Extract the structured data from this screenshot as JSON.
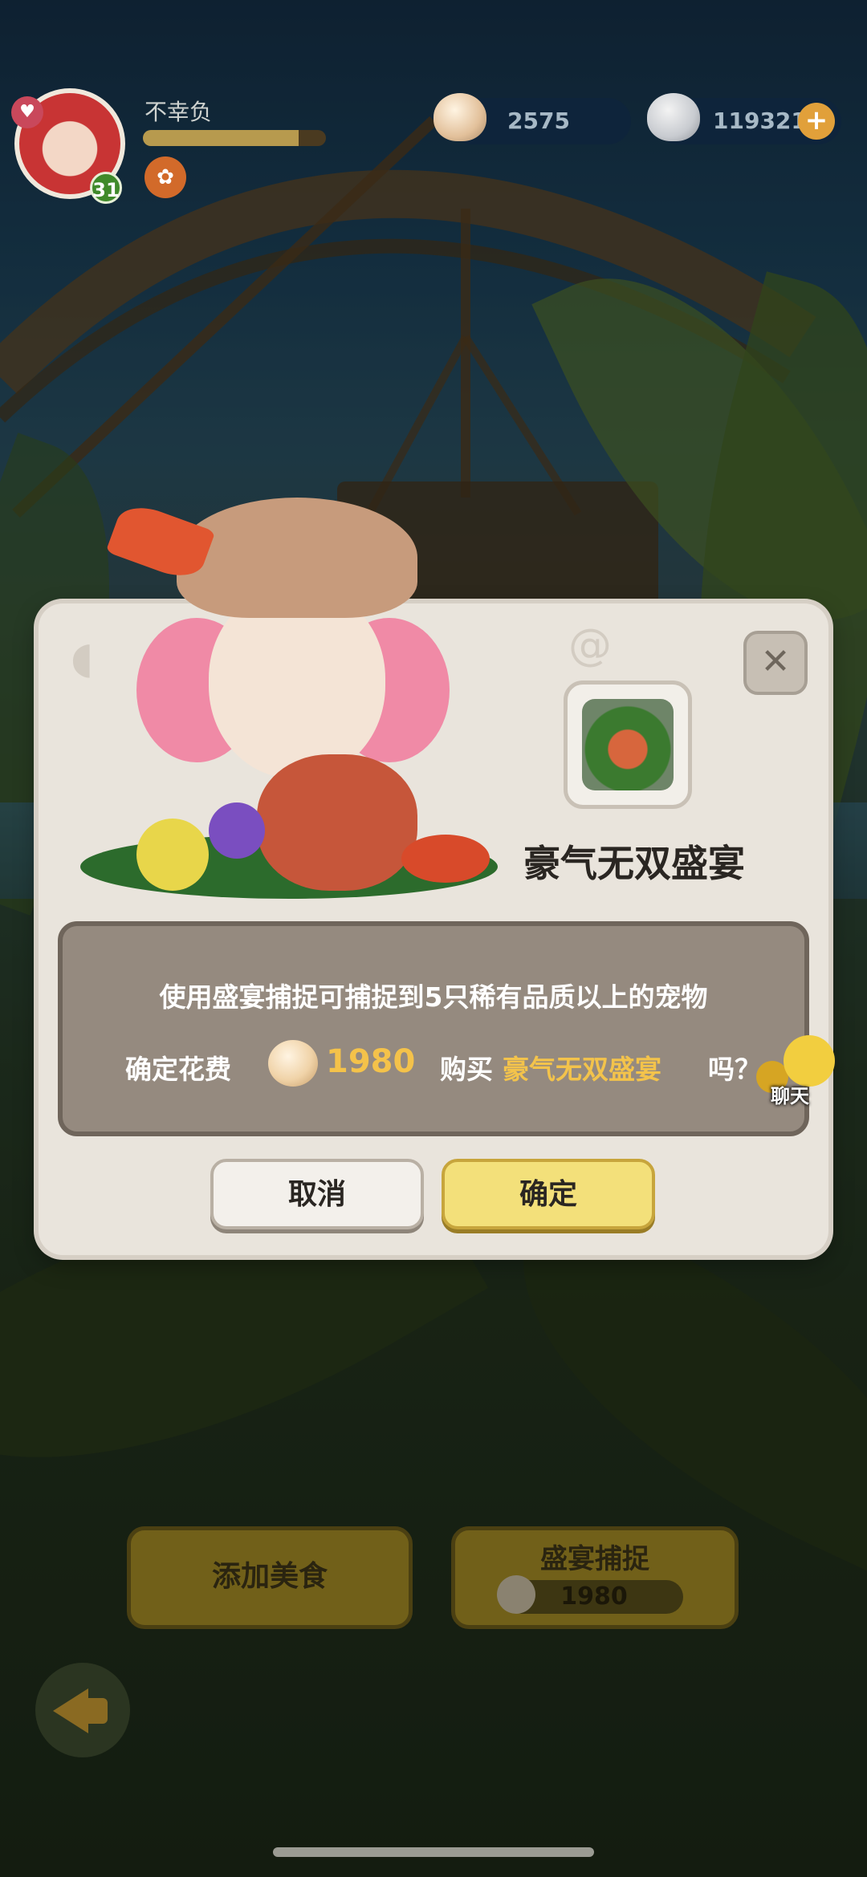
{
  "hud": {
    "player_name": "不幸负",
    "level": "31",
    "exp_fraction": 0.85,
    "shell_amount": "2575",
    "stone_amount": "119321",
    "plus_symbol": "+"
  },
  "dialog": {
    "close_symbol": "✕",
    "item_title": "豪气无双盛宴",
    "message_line1": "使用盛宴捕捉可捕捉到5只稀有品质以上的宠物",
    "confirm_prefix": "确定花费",
    "cost_value": "1980",
    "buy_prefix": "购买",
    "buy_item": "豪气无双盛宴",
    "buy_suffix": "吗？",
    "cancel_label": "取消",
    "ok_label": "确定"
  },
  "chat": {
    "label": "聊天"
  },
  "bottom": {
    "add_food_label": "添加美食",
    "feast_catch_label": "盛宴捕捉",
    "feast_cost": "1980"
  },
  "colors": {
    "dialog_bg": "#e9e4dc",
    "message_box": "#958a7f",
    "highlight": "#f3c34b",
    "ok_button": "#f3e07a"
  },
  "icons": {
    "avatar": "player-avatar",
    "shell": "shell-icon",
    "stone": "stone-icon",
    "close": "close-icon",
    "item": "feast-item-icon",
    "back": "back-arrow-icon",
    "chat": "chat-icon"
  }
}
